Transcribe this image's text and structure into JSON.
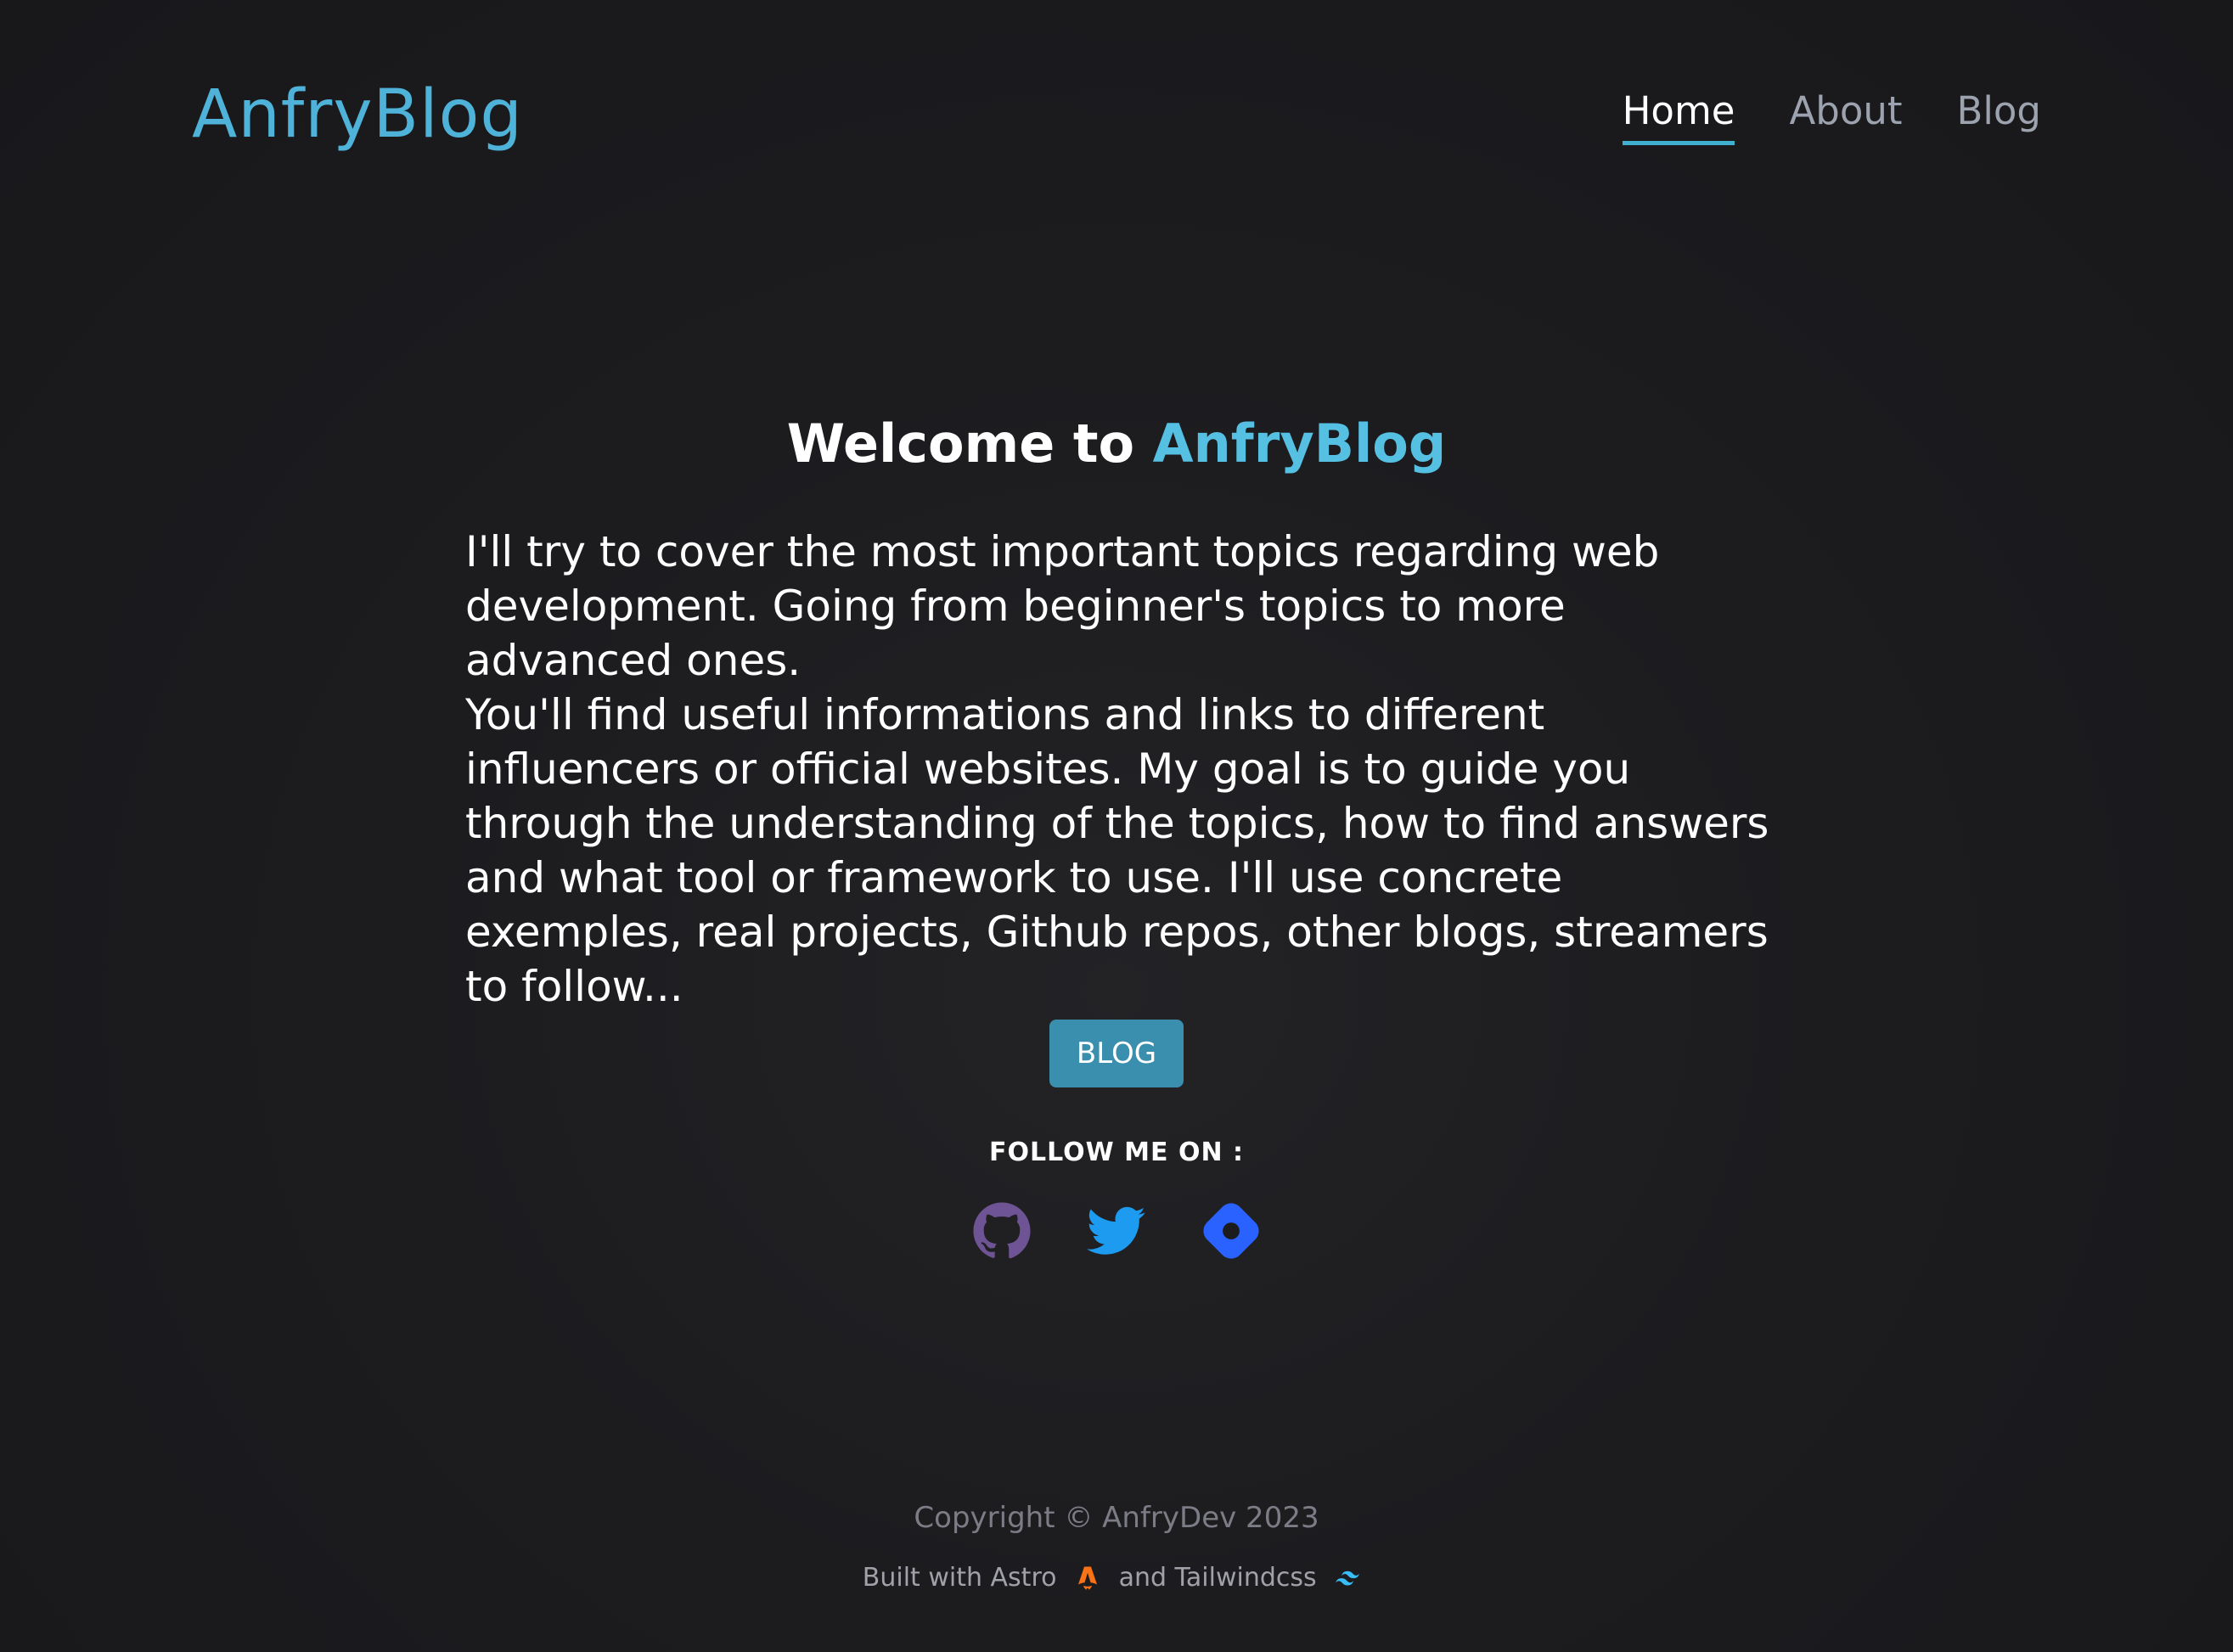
{
  "header": {
    "logo": "AnfryBlog",
    "nav": [
      {
        "label": "Home",
        "active": true
      },
      {
        "label": "About",
        "active": false
      },
      {
        "label": "Blog",
        "active": false
      }
    ]
  },
  "hero": {
    "title_prefix": "Welcome to",
    "title_brand": "AnfryBlog",
    "paragraph_1": "I'll try to cover the most important topics regarding web development. Going from beginner's topics to more advanced ones.",
    "paragraph_2": "You'll find useful informations and links to different influencers or official websites. My goal is to guide you through the understanding of the topics, how to find answers and what tool or framework to use. I'll use concrete exemples, real projects, Github repos, other blogs, streamers to follow...",
    "button_label": "BLOG"
  },
  "social": {
    "label": "FOLLOW ME ON :",
    "icons": [
      "github-icon",
      "twitter-icon",
      "hashnode-icon"
    ],
    "colors": {
      "github": "#6e5494",
      "twitter": "#1d9bf0",
      "hashnode": "#2962ff"
    }
  },
  "footer": {
    "copyright": "Copyright © AnfryDev 2023",
    "built_with_prefix": "Built with Astro",
    "built_with_suffix": "and Tailwindcss",
    "icons": [
      "astro-icon",
      "tailwind-icon"
    ]
  },
  "colors": {
    "accent": "#4fb3d9",
    "button": "#3a8fae",
    "background": "#1c1c1f"
  }
}
